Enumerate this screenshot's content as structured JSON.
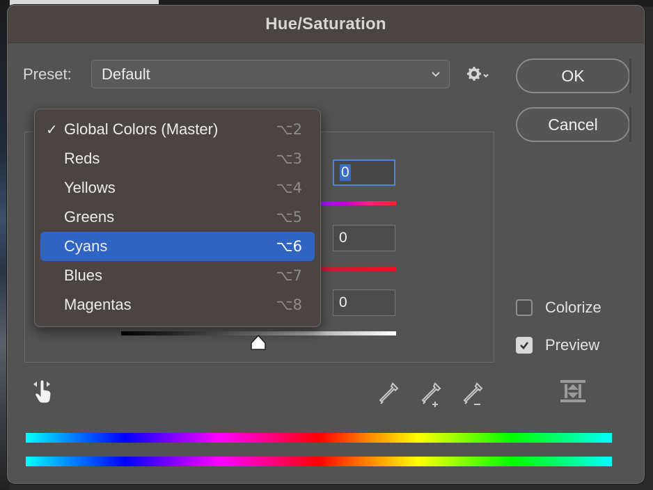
{
  "dialog": {
    "title": "Hue/Saturation",
    "preset_label": "Preset:",
    "preset_value": "Default",
    "ok_label": "OK",
    "cancel_label": "Cancel"
  },
  "channel_menu": {
    "items": [
      {
        "label": "Global Colors (Master)",
        "shortcut": "⌥2",
        "checked": true,
        "highlighted": false
      },
      {
        "label": "Reds",
        "shortcut": "⌥3",
        "checked": false,
        "highlighted": false
      },
      {
        "label": "Yellows",
        "shortcut": "⌥4",
        "checked": false,
        "highlighted": false
      },
      {
        "label": "Greens",
        "shortcut": "⌥5",
        "checked": false,
        "highlighted": false
      },
      {
        "label": "Cyans",
        "shortcut": "⌥6",
        "checked": false,
        "highlighted": true
      },
      {
        "label": "Blues",
        "shortcut": "⌥7",
        "checked": false,
        "highlighted": false
      },
      {
        "label": "Magentas",
        "shortcut": "⌥8",
        "checked": false,
        "highlighted": false
      }
    ]
  },
  "adjustments": {
    "hue_value": "0",
    "saturation_value": "0",
    "lightness_value": "0"
  },
  "options": {
    "colorize_label": "Colorize",
    "colorize_checked": false,
    "preview_label": "Preview",
    "preview_checked": true
  },
  "icons": {
    "gear": "gear-icon",
    "hand": "targeted-adjustment-hand-icon",
    "eyedropper": "eyedropper-icon",
    "eyedropper_plus": "eyedropper-plus-icon",
    "eyedropper_minus": "eyedropper-minus-icon",
    "adjust": "range-adjust-icon"
  },
  "colors": {
    "dialog_bg": "#535353",
    "titlebar_bg": "#4a4542",
    "menu_bg": "#4a4443",
    "highlight": "#2f64c2",
    "focus_ring": "#4d88d6"
  }
}
